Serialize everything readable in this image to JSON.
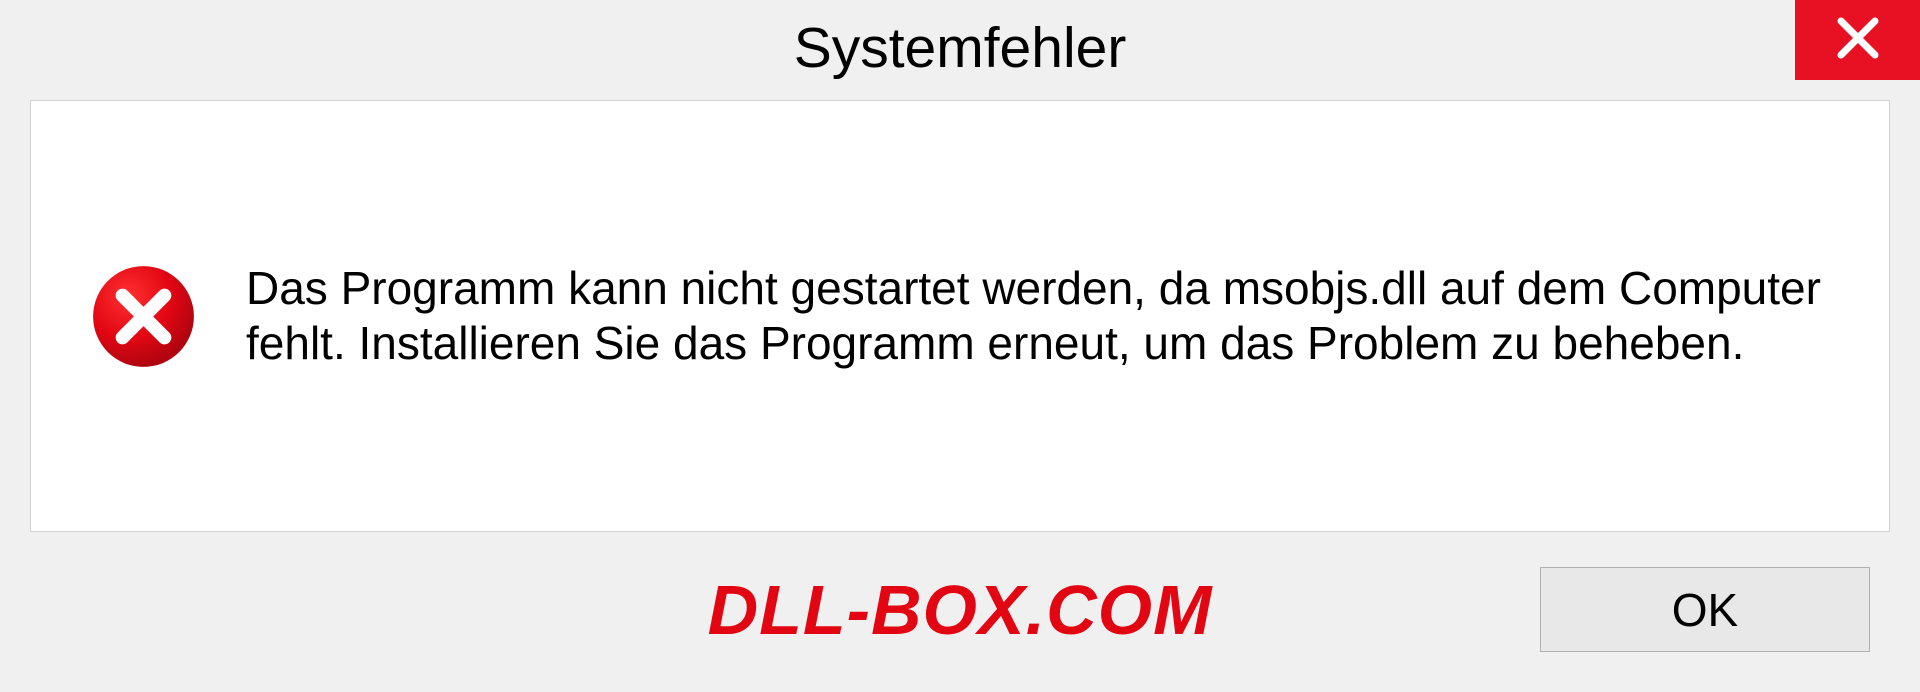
{
  "dialog": {
    "title": "Systemfehler",
    "message": "Das Programm kann nicht gestartet werden, da msobjs.dll auf dem Computer fehlt. Installieren Sie das Programm erneut, um das Problem zu beheben.",
    "ok_label": "OK"
  },
  "watermark": "DLL-BOX.COM",
  "colors": {
    "close_bg": "#e81123",
    "error_icon": "#e20613",
    "watermark": "#e20613"
  }
}
